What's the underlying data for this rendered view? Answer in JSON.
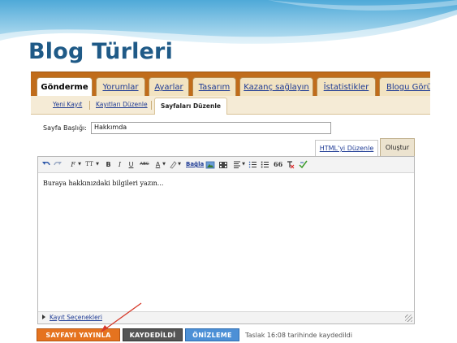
{
  "slide": {
    "title": "Blog Türleri"
  },
  "tabs": [
    {
      "label": "Gönderme",
      "active": true
    },
    {
      "label": "Yorumlar",
      "active": false
    },
    {
      "label": "Ayarlar",
      "active": false
    },
    {
      "label": "Tasarım",
      "active": false
    },
    {
      "label": "Kazanç sağlayın",
      "active": false
    },
    {
      "label": "İstatistikler",
      "active": false
    },
    {
      "label": "Blogu Görün",
      "active": false
    }
  ],
  "subnav": {
    "new_post": "Yeni Kayıt",
    "edit_posts": "Kayıtları Düzenle",
    "edit_pages": "Sayfaları Düzenle"
  },
  "form": {
    "page_title_label": "Sayfa Başlığı:",
    "page_title_value": "Hakkımda"
  },
  "editor": {
    "mode_html": "HTML'yi Düzenle",
    "mode_compose": "Oluştur",
    "content": "Buraya hakkınızdaki bilgileri yazın...",
    "post_options": "Kayıt Seçenekleri",
    "toolbar": {
      "bold": "B",
      "italic": "I",
      "underline": "U",
      "strike": "ABC",
      "text_color": "A",
      "link": "Bağla",
      "quote": "66",
      "font": "F",
      "size": "TT"
    }
  },
  "actions": {
    "publish": "SAYFAYI YAYINLA",
    "saved": "KAYDEDİLDİ",
    "preview": "ÖNİZLEME",
    "draft_note": "Taslak 16:08 tarihinde kaydedildi"
  },
  "colors": {
    "title": "#1f5a87",
    "tabbar": "#c06c1b",
    "publish": "#e5731f",
    "saved": "#555555",
    "preview": "#4d90d6",
    "arrow": "#d63a2a"
  }
}
